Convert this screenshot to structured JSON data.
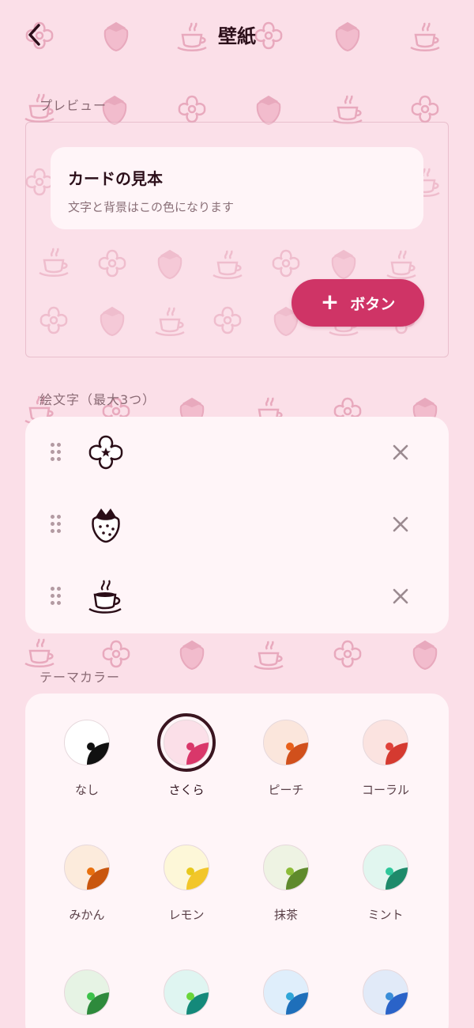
{
  "header": {
    "title": "壁紙",
    "back_icon": "chevron-left-icon"
  },
  "preview": {
    "section_label": "プレビュー",
    "card_title": "カードの見本",
    "card_description": "文字と背景はこの色になります",
    "button_label": "ボタン",
    "button_icon": "plus-icon"
  },
  "emoji": {
    "section_label": "絵文字（最大3つ）",
    "items": [
      {
        "name": "cherry-blossom-icon"
      },
      {
        "name": "strawberry-icon"
      },
      {
        "name": "coffee-cup-icon"
      }
    ],
    "remove_icon": "close-icon",
    "drag_icon": "drag-handle-icon"
  },
  "theme": {
    "section_label": "テーマカラー",
    "selected": "さくら",
    "swatches": [
      {
        "label": "なし",
        "bg": "#ffffff",
        "accent": "#111111",
        "dot": "#111111"
      },
      {
        "label": "さくら",
        "bg": "#fbdfe8",
        "accent": "#d9376a",
        "dot": "#d9376a"
      },
      {
        "label": "ピーチ",
        "bg": "#fbe6dc",
        "accent": "#d1501c",
        "dot": "#e8601a"
      },
      {
        "label": "コーラル",
        "bg": "#fbe3e0",
        "accent": "#d53a30",
        "dot": "#e0423a"
      },
      {
        "label": "みかん",
        "bg": "#fcebdc",
        "accent": "#c9560e",
        "dot": "#e8700e"
      },
      {
        "label": "レモン",
        "bg": "#fdf7d8",
        "accent": "#f2c62a",
        "dot": "#e8c81c"
      },
      {
        "label": "抹茶",
        "bg": "#eef3e3",
        "accent": "#5f8a2c",
        "dot": "#8cbc38"
      },
      {
        "label": "ミント",
        "bg": "#e1f6ef",
        "accent": "#1e8a6a",
        "dot": "#2ec79a"
      },
      {
        "label": "",
        "bg": "#e6f3e4",
        "accent": "#2e8a3c",
        "dot": "#3cc24a"
      },
      {
        "label": "",
        "bg": "#dff5f1",
        "accent": "#14897a",
        "dot": "#6ad63a"
      },
      {
        "label": "",
        "bg": "#dfeefb",
        "accent": "#1e6fba",
        "dot": "#2fa6d8"
      },
      {
        "label": "",
        "bg": "#e1eaf8",
        "accent": "#2a63c8",
        "dot": "#3a8ed8"
      }
    ]
  },
  "colors": {
    "page_background": "#fbdfe8",
    "card_background": "#fff5f8",
    "primary": "#cf3466",
    "text_primary": "#2c0f1a",
    "text_secondary": "#8a6a74"
  }
}
